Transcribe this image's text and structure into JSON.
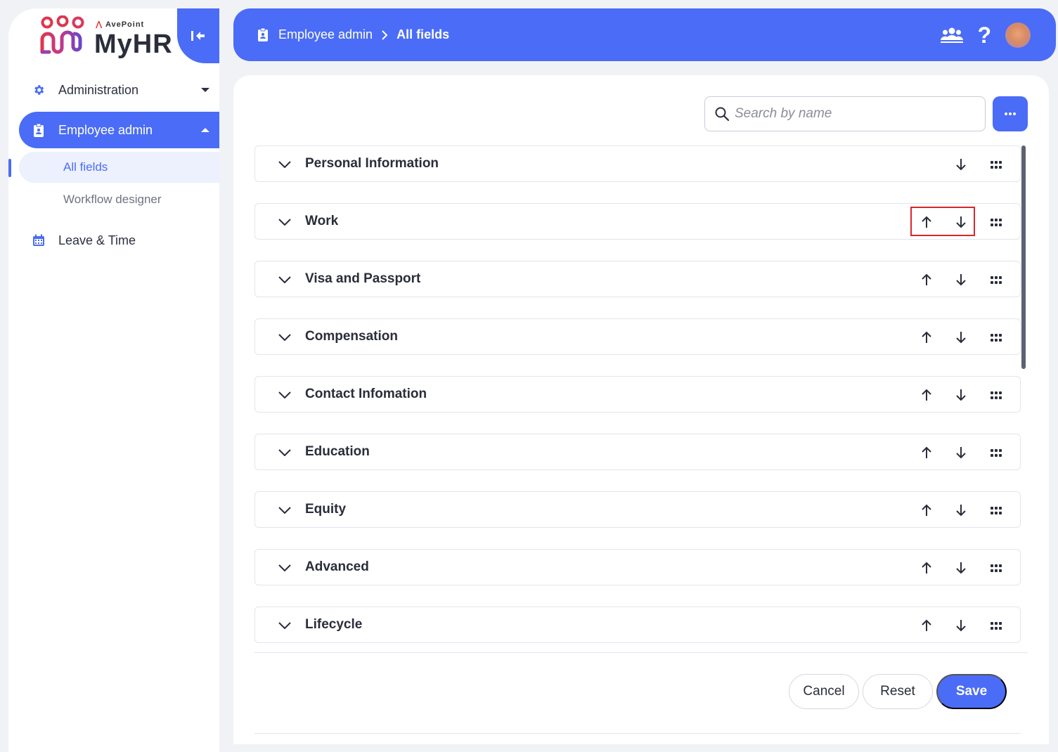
{
  "brand": {
    "vendor": "AvePoint",
    "product": "MyHR"
  },
  "sidebar": {
    "items": [
      {
        "label": "Administration",
        "icon": "gear-icon",
        "expanded": false
      },
      {
        "label": "Employee admin",
        "icon": "clipboard-badge-icon",
        "expanded": true,
        "children": [
          {
            "label": "All fields",
            "active": true
          },
          {
            "label": "Workflow designer",
            "active": false
          }
        ]
      },
      {
        "label": "Leave & Time",
        "icon": "calendar-icon",
        "expanded": false
      }
    ]
  },
  "header": {
    "breadcrumb": [
      "Employee admin",
      "All fields"
    ],
    "icons": [
      "team-icon",
      "help-icon",
      "avatar"
    ]
  },
  "toolbar": {
    "search_placeholder": "Search by name",
    "more_icon": "ellipsis-icon"
  },
  "sections": [
    {
      "title": "Personal Information",
      "can_move_up": false,
      "can_move_down": true
    },
    {
      "title": "Work",
      "can_move_up": true,
      "can_move_down": true,
      "highlighted": true
    },
    {
      "title": "Visa and Passport",
      "can_move_up": true,
      "can_move_down": true
    },
    {
      "title": "Compensation",
      "can_move_up": true,
      "can_move_down": true
    },
    {
      "title": "Contact Infomation",
      "can_move_up": true,
      "can_move_down": true
    },
    {
      "title": "Education",
      "can_move_up": true,
      "can_move_down": true
    },
    {
      "title": "Equity",
      "can_move_up": true,
      "can_move_down": true
    },
    {
      "title": "Advanced",
      "can_move_up": true,
      "can_move_down": true
    },
    {
      "title": "Lifecycle",
      "can_move_up": true,
      "can_move_down": true
    }
  ],
  "footer": {
    "cancel_label": "Cancel",
    "reset_label": "Reset",
    "save_label": "Save"
  },
  "colors": {
    "accent": "#4a6cf7",
    "highlight": "#d9262c",
    "background": "#f1f2f6"
  }
}
